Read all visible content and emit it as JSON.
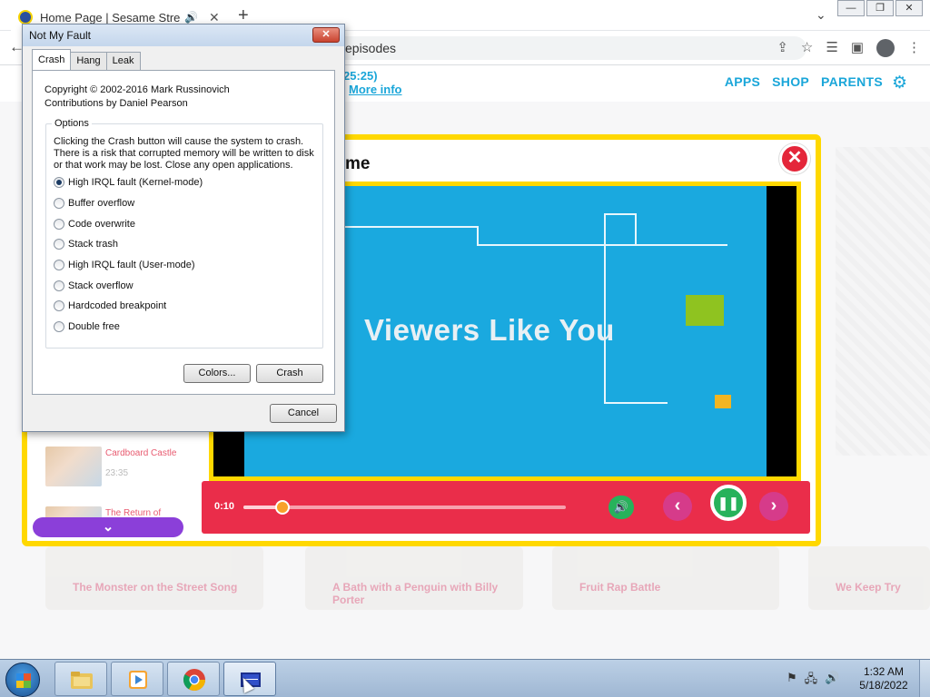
{
  "browser": {
    "tab_title": "Home Page | Sesame Street",
    "tab_close": "✕",
    "new_tab": "+",
    "address_text": "episodes",
    "window_controls": [
      "—",
      "❐",
      "✕"
    ]
  },
  "site": {
    "episode_time": "25:25)",
    "more_info": "More info",
    "nav": [
      "APPS",
      "SHOP",
      "PARENTS"
    ],
    "colors": {
      "brand_blue": "#1aa6d9",
      "modal_yellow": "#ffd800",
      "player_red": "#ea2d4a"
    }
  },
  "video_modal": {
    "title": "me",
    "close_label": "✕",
    "screen_text": "Viewers Like You",
    "current_time": "0:10",
    "progress": 0.12,
    "episodes": [
      {
        "name": "Cardboard Castle",
        "duration": "23:35"
      },
      {
        "name": "The Return of",
        "duration": ""
      }
    ],
    "scroll_label": "⌄"
  },
  "background_cards": [
    "The Monster on the Street Song",
    "A Bath with a Penguin with Billy Porter",
    "Fruit Rap Battle",
    "We Keep Try"
  ],
  "dialog": {
    "title": "Not My Fault",
    "close_label": "✕",
    "tabs": [
      "Crash",
      "Hang",
      "Leak"
    ],
    "active_tab": "Crash",
    "copyright": "Copyright © 2002-2016 Mark Russinovich",
    "contributions": "Contributions by Daniel Pearson",
    "options_label": "Options",
    "warning": "Clicking the Crash button will cause the system to crash. There is a risk that corrupted memory will be written to disk or that work may be lost. Close any open applications.",
    "options": [
      "High IRQL fault (Kernel-mode)",
      "Buffer overflow",
      "Code overwrite",
      "Stack trash",
      "High IRQL fault (User-mode)",
      "Stack overflow",
      "Hardcoded breakpoint",
      "Double free"
    ],
    "selected_option": "High IRQL fault (Kernel-mode)",
    "colors_button": "Colors...",
    "crash_button": "Crash",
    "cancel_button": "Cancel"
  },
  "taskbar": {
    "time": "1:32 AM",
    "date": "5/18/2022"
  }
}
